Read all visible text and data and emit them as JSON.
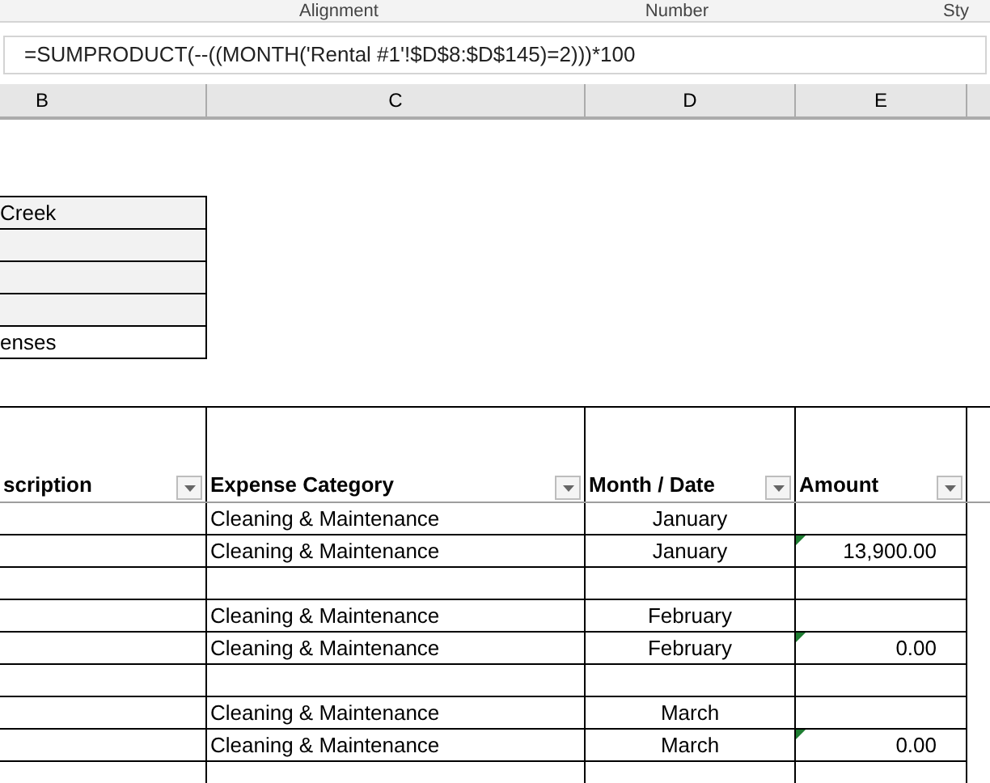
{
  "ribbon_groups": [
    "Alignment",
    "Number",
    "Sty"
  ],
  "formula_bar": {
    "value": "=SUMPRODUCT(--((MONTH('Rental #1'!$D$8:$D$145)=2)))*100"
  },
  "column_headers": [
    "B",
    "C",
    "D",
    "E"
  ],
  "info_box": [
    {
      "text": "Creek",
      "shaded": true
    },
    {
      "shaded": true
    },
    {
      "shaded": true
    },
    {
      "shaded": true
    },
    {
      "text": "enses",
      "shaded": false
    }
  ],
  "table": {
    "columns": [
      "scription",
      "Expense Category",
      "Month / Date",
      "Amount"
    ],
    "rows": [
      {
        "kind": "entry",
        "category": "Cleaning & Maintenance",
        "month": "January",
        "flagged": false
      },
      {
        "kind": "entry",
        "category": "Cleaning & Maintenance",
        "month": "January",
        "amount": "13,900.00",
        "flagged": true
      },
      {
        "kind": "blank"
      },
      {
        "kind": "entry",
        "category": "Cleaning & Maintenance",
        "month": "February",
        "flagged": false
      },
      {
        "kind": "entry",
        "category": "Cleaning & Maintenance",
        "month": "February",
        "amount": "0.00",
        "flagged": true
      },
      {
        "kind": "blank"
      },
      {
        "kind": "entry",
        "category": "Cleaning & Maintenance",
        "month": "March",
        "flagged": false
      },
      {
        "kind": "entry",
        "category": "Cleaning & Maintenance",
        "month": "March",
        "amount": "0.00",
        "flagged": true
      },
      {
        "kind": "blank"
      }
    ]
  }
}
